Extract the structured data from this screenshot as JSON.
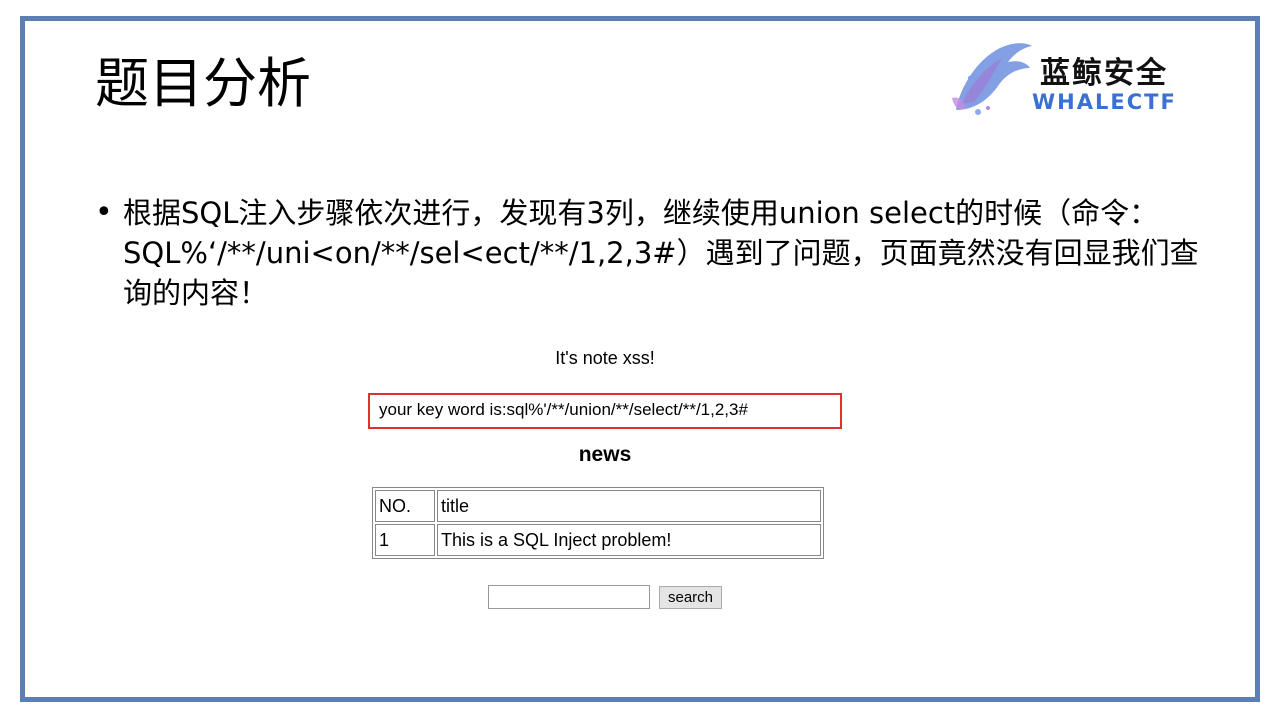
{
  "slide": {
    "title": "题目分析",
    "bullet": "根据SQL注入步骤依次进行，发现有3列，继续使用union select的时候（命令：SQL%‘/**/uni<on/**/sel<ect/**/1,2,3#）遇到了问题，页面竟然没有回显我们查询的内容！"
  },
  "logo": {
    "cn": "蓝鲸安全",
    "en": "WHALECTF"
  },
  "webpage": {
    "note": "It's note xss!",
    "keyword": "your key word is:sql%'/**/union/**/select/**/1,2,3#",
    "heading": "news",
    "table": {
      "headers": [
        "NO.",
        "title"
      ],
      "rows": [
        [
          "1",
          "This is a SQL Inject problem!"
        ]
      ]
    },
    "search_button": "search",
    "search_value": ""
  },
  "colors": {
    "frame": "#5b7fb3",
    "keyword_border": "#e0302a",
    "logo_blue": "#3b6fd1"
  }
}
